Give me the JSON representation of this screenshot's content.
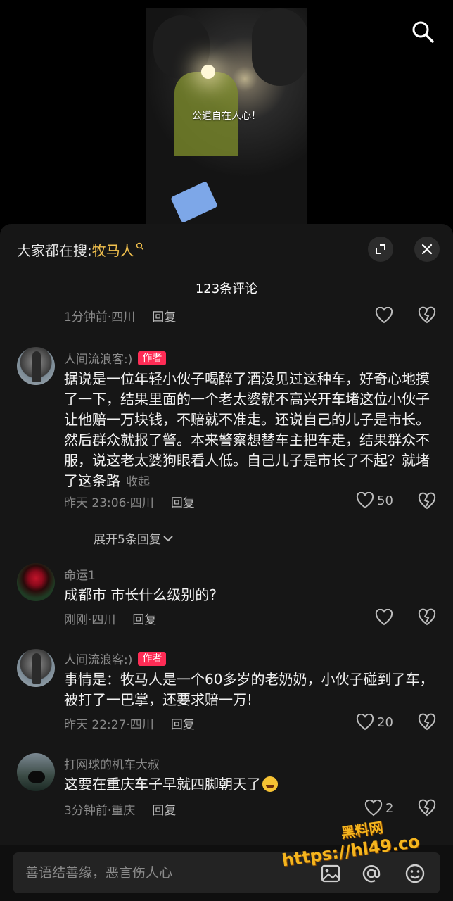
{
  "video": {
    "caption": "公道自在人心！"
  },
  "panel": {
    "hot_search_prefix": "大家都在搜: ",
    "hot_search_keyword": "牧马人",
    "comment_count_title": "123条评论"
  },
  "top_partial": {
    "meta": "1分钟前·四川",
    "reply": "回复"
  },
  "comments": [
    {
      "user": "人间流浪客:)",
      "tag": "作者",
      "text": "据说是一位年轻小伙子喝醉了酒没见过这种车，好奇心地摸了一下，结果里面的一个老太婆就不高兴开车堵这位小伙子让他赔一万块钱，不赔就不准走。还说自己的儿子是市长。然后群众就报了警。本来警察想替车主把车走，结果群众不服，说这老太婆狗眼看人低。自己儿子是市长了不起？就堵了这条路",
      "collapse": "收起",
      "meta": "昨天 23:06·四川",
      "reply": "回复",
      "likes": "50"
    },
    {
      "user": "命运1",
      "text": "成都市 市长什么级别的?",
      "meta": "刚刚·四川",
      "reply": "回复"
    },
    {
      "user": "人间流浪客:)",
      "tag": "作者",
      "text": "事情是：牧马人是一个60多岁的老奶奶，小伙子碰到了车，被打了一巴掌，还要求赔一万!",
      "meta": "昨天 22:27·四川",
      "reply": "回复",
      "likes": "20"
    },
    {
      "user": "打网球的机车大叔",
      "text": "这要在重庆车子早就四脚朝天了",
      "meta": "3分钟前·重庆",
      "reply": "回复",
      "likes": "2"
    }
  ],
  "expand_replies": "展开5条回复",
  "input": {
    "placeholder": "善语结善缘，恶言伤人心"
  },
  "watermark": {
    "line1": "黑料网",
    "line2": "https://hl49.co"
  },
  "icons": {
    "search": "search-icon",
    "expand": "expand-icon",
    "close": "close-icon",
    "heart": "heart-icon",
    "broken_heart": "broken-heart-icon",
    "image": "image-icon",
    "at": "at-icon",
    "emoji": "emoji-icon"
  },
  "colors": {
    "accent": "#f2c14e",
    "author_tag": "#fe2c55",
    "panel_bg": "#161616"
  }
}
